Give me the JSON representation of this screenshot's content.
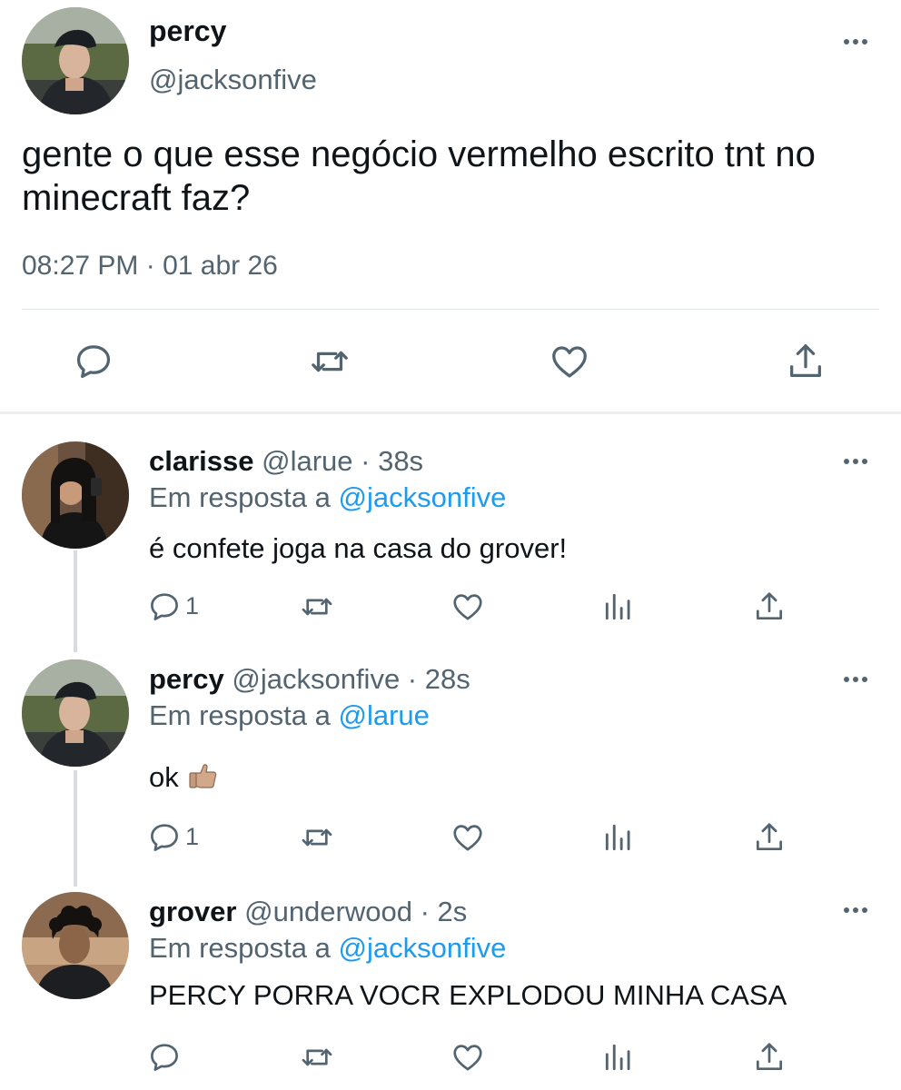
{
  "colors": {
    "text": "#0f1419",
    "secondary": "#536471",
    "link": "#1d9bf0",
    "separator": "#e1e6ea"
  },
  "main": {
    "name": "percy",
    "handle": "@jacksonfive",
    "text": "gente o que esse negócio vermelho escrito tnt no minecraft faz?",
    "timestamp": "08:27 PM · 01 abr 26",
    "actions": [
      "reply-icon",
      "retweet-icon",
      "like-icon",
      "share-icon"
    ]
  },
  "replies": [
    {
      "name": "clarisse",
      "meta": "@larue · 38s",
      "in_reply_prefix": "Em resposta a",
      "in_reply_to": "@jacksonfive",
      "text": "é confete joga na casa do grover!",
      "reply_count": "1"
    },
    {
      "name": "percy",
      "meta": "@jacksonfive · 28s",
      "in_reply_prefix": "Em resposta a",
      "in_reply_to": "@larue",
      "text": "ok",
      "emoji": "thumbs-up-icon",
      "reply_count": "1"
    },
    {
      "name": "grover",
      "meta": "@underwood · 2s",
      "in_reply_prefix": "Em resposta a",
      "in_reply_to": "@jacksonfive",
      "text": "PERCY PORRA VOCR EXPLODOU MINHA CASA",
      "reply_count": ""
    }
  ]
}
